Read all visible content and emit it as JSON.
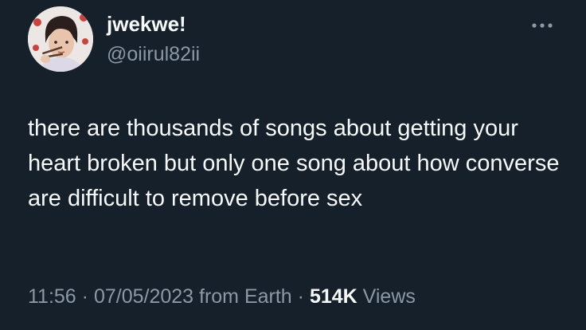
{
  "author": {
    "display_name": "jwekwe!",
    "handle": "@oiirul82ii",
    "avatar_icon": "profile-photo"
  },
  "actions": {
    "more_icon": "more-horizontal-icon"
  },
  "tweet": {
    "text": "there are thousands of songs about getting your heart broken but only one song about how converse are difficult to remove before sex"
  },
  "meta": {
    "time": "11:56",
    "separator_1": " · ",
    "date": "07/05/2023",
    "source": " from Earth",
    "separator_2": " · ",
    "views_count": "514K",
    "views_label": " Views"
  },
  "colors": {
    "background": "#15202b",
    "text_primary": "#f7f9f9",
    "text_secondary": "#8b98a5"
  }
}
